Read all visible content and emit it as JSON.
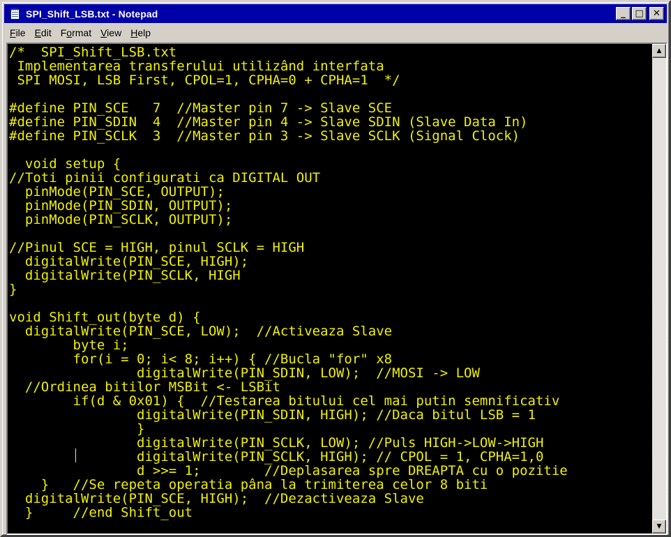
{
  "window": {
    "title": "SPI_Shift_LSB.txt - Notepad",
    "buttons": {
      "minimize": "_",
      "maximize": "□",
      "close": "✕"
    }
  },
  "menu": [
    {
      "accel": "F",
      "rest": "ile"
    },
    {
      "accel": "E",
      "rest": "dit"
    },
    {
      "pre": "F",
      "accel": "o",
      "rest": "rmat"
    },
    {
      "accel": "V",
      "rest": "iew"
    },
    {
      "accel": "H",
      "rest": "elp"
    }
  ],
  "editor": {
    "text_color": "#f0f000",
    "background": "#000000",
    "lines": [
      "/*  SPI_Shift_LSB.txt",
      " Implementarea transferului utilizând interfata",
      " SPI MOSI, LSB First, CPOL=1, CPHA=0 + CPHA=1  */",
      "",
      "#define PIN_SCE   7  //Master pin 7 -> Slave SCE",
      "#define PIN_SDIN  4  //Master pin 4 -> Slave SDIN (Slave Data In)",
      "#define PIN_SCLK  3  //Master pin 3 -> Slave SCLK (Signal Clock)",
      "",
      "  void setup {",
      "//Toti pinii configurati ca DIGITAL OUT",
      "  pinMode(PIN_SCE, OUTPUT);",
      "  pinMode(PIN_SDIN, OUTPUT);",
      "  pinMode(PIN_SCLK, OUTPUT);",
      "",
      "//Pinul SCE = HIGH, pinul SCLK = HIGH",
      "  digitalWrite(PIN_SCE, HIGH);",
      "  digitalWrite(PIN_SCLK, HIGH",
      "}",
      "",
      "void Shift_out(byte d) {",
      "  digitalWrite(PIN_SCE, LOW);  //Activeaza Slave",
      "        byte i;",
      "        for(i = 0; i< 8; i++) { //Bucla \"for\" x8",
      "                digitalWrite(PIN_SDIN, LOW);  //MOSI -> LOW",
      "  //Ordinea bitilor MSBit <- LSBit",
      "        if(d & 0x01) {  //Testarea bitului cel mai putin semnificativ",
      "                digitalWrite(PIN_SDIN, HIGH); //Daca bitul LSB = 1",
      "                }",
      "                digitalWrite(PIN_SCLK, LOW); //Puls HIGH->LOW->HIGH",
      "                digitalWrite(PIN_SCLK, HIGH); // CPOL = 1, CPHA=1,0",
      "                d >>= 1;        //Deplasarea spre DREAPTA cu o pozitie",
      "    }   //Se repeta operatia pâna la trimiterea celor 8 biti",
      "  digitalWrite(PIN_SCE, HIGH);  //Dezactiveaza Slave",
      "  }     //end Shift_out"
    ]
  },
  "scrollbar": {
    "up_arrow": "▲",
    "down_arrow": "▼"
  }
}
